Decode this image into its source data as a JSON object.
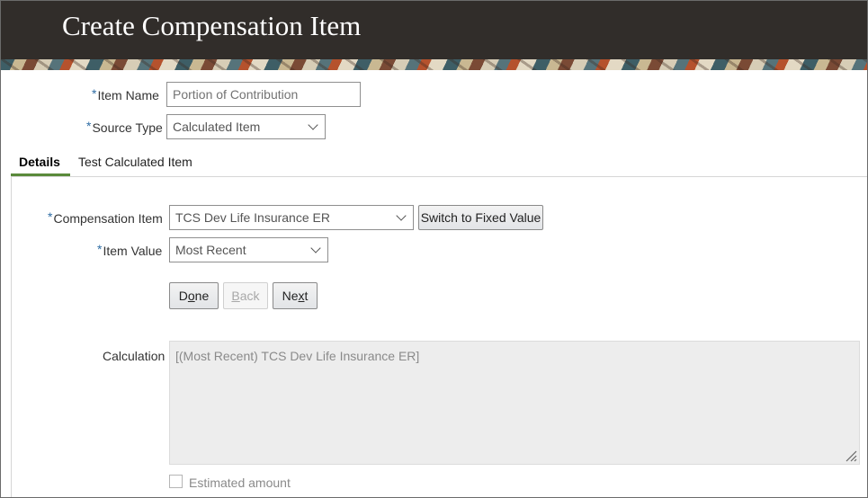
{
  "header": {
    "title": "Create Compensation Item"
  },
  "form": {
    "item_name": {
      "label": "Item Name",
      "value": "Portion of Contribution",
      "required_marker": "*"
    },
    "source_type": {
      "label": "Source Type",
      "value": "Calculated Item",
      "required_marker": "*"
    }
  },
  "tabs": [
    {
      "label": "Details",
      "active": true
    },
    {
      "label": "Test Calculated Item",
      "active": false
    }
  ],
  "details": {
    "compensation_item": {
      "label": "Compensation Item",
      "value": "TCS Dev Life Insurance ER",
      "required_marker": "*"
    },
    "switch_button": {
      "label": "Switch to Fixed Value"
    },
    "item_value": {
      "label": "Item Value",
      "value": "Most Recent",
      "required_marker": "*"
    },
    "buttons": {
      "done": {
        "pre": "D",
        "mnemonic": "o",
        "post": "ne"
      },
      "back": {
        "pre": "",
        "mnemonic": "B",
        "post": "ack",
        "disabled": true
      },
      "next": {
        "pre": "Ne",
        "mnemonic": "x",
        "post": "t"
      }
    },
    "calculation": {
      "label": "Calculation",
      "value": "[(Most Recent) TCS Dev Life Insurance ER]"
    },
    "estimated_amount": {
      "label": "Estimated amount",
      "checked": false
    }
  },
  "colors": {
    "header_bg": "#312d2a",
    "required": "#2e6da4",
    "tab_accent": "#5a8a3b"
  },
  "icons": {
    "dropdown": "chevron-down-icon",
    "resize": "resize-handle-icon"
  }
}
